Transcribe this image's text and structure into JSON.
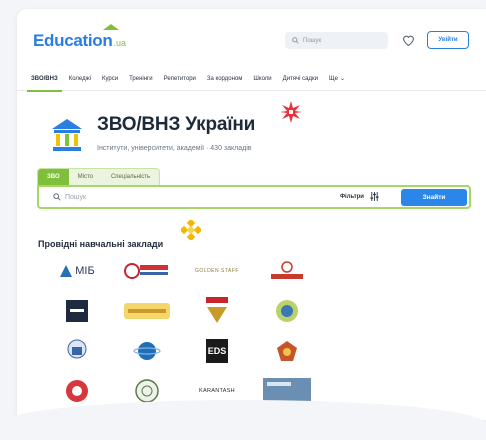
{
  "header": {
    "logo_main": "Education",
    "logo_suffix": ".ua",
    "search_placeholder": "Пошук",
    "login_label": "Увійти"
  },
  "nav": {
    "items": [
      "ЗВО/ВНЗ",
      "Коледжі",
      "Курси",
      "Тренінги",
      "Репетитори",
      "За кордоном",
      "Школи",
      "Дитячі садки",
      "Ще"
    ],
    "active_index": 0
  },
  "page": {
    "title": "ЗВО/ВНЗ України",
    "subtitle": "Інститути, університети, академії · 430 закладів"
  },
  "filter": {
    "tabs": [
      "ЗВО",
      "Місто",
      "Спеціальність"
    ],
    "active_tab": 0,
    "search_placeholder": "Пошук",
    "filters_label": "Фільтри",
    "find_label": "Знайти"
  },
  "section": {
    "title": "Провідні навчальні заклади"
  },
  "institutions": [
    {
      "label": "МІБ",
      "icon": "mib-logo"
    },
    {
      "label": "",
      "icon": "university-logo-red-blue"
    },
    {
      "label": "GOLDEN STAFF",
      "icon": "golden-staff-logo"
    },
    {
      "label": "EUROCOLLEGE",
      "icon": "eurocollege-logo"
    },
    {
      "label": "",
      "icon": "dark-square-logo"
    },
    {
      "label": "Step Ahead",
      "icon": "step-ahead-logo"
    },
    {
      "label": "КНБІМ",
      "icon": "knbim-logo"
    },
    {
      "label": "",
      "icon": "green-seal-logo"
    },
    {
      "label": "",
      "icon": "building-crest-logo"
    },
    {
      "label": "",
      "icon": "globe-logo"
    },
    {
      "label": "EDS",
      "icon": "eds-logo"
    },
    {
      "label": "",
      "icon": "red-crest-logo"
    },
    {
      "label": "",
      "icon": "red-round-logo"
    },
    {
      "label": "",
      "icon": "green-round-seal-logo"
    },
    {
      "label": "KARANTASH",
      "icon": "karantash-logo"
    },
    {
      "label": "",
      "icon": "blue-banner-logo"
    }
  ],
  "colors": {
    "brand_blue": "#2a7de1",
    "brand_green": "#7fbf3a",
    "accent_red": "#e8323c",
    "accent_yellow": "#f2b800"
  }
}
